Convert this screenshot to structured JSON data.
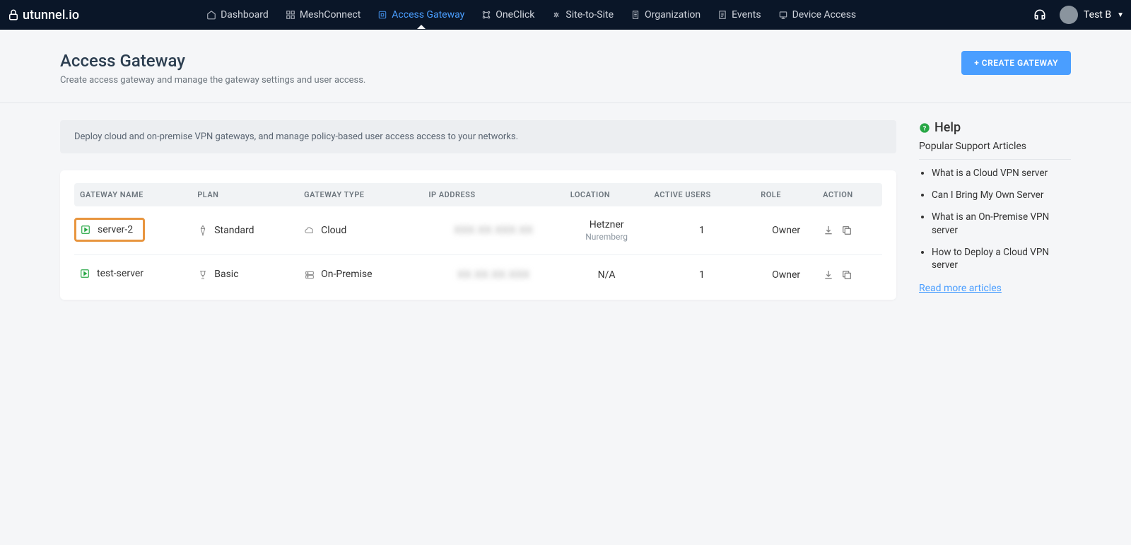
{
  "brand": "utunnel.io",
  "nav": [
    {
      "label": "Dashboard",
      "icon": "home"
    },
    {
      "label": "MeshConnect",
      "icon": "mesh"
    },
    {
      "label": "Access Gateway",
      "icon": "gateway",
      "active": true
    },
    {
      "label": "OneClick",
      "icon": "oneclick"
    },
    {
      "label": "Site-to-Site",
      "icon": "sitesite"
    },
    {
      "label": "Organization",
      "icon": "org"
    },
    {
      "label": "Events",
      "icon": "events"
    },
    {
      "label": "Device Access",
      "icon": "device"
    }
  ],
  "user": {
    "name": "Test B"
  },
  "page": {
    "title": "Access Gateway",
    "subtitle": "Create access gateway and manage the gateway settings and user access.",
    "create_button": "+ CREATE GATEWAY",
    "info": "Deploy cloud and on-premise VPN gateways, and manage policy-based user access access to your networks."
  },
  "table": {
    "columns": [
      "GATEWAY NAME",
      "PLAN",
      "GATEWAY TYPE",
      "IP ADDRESS",
      "LOCATION",
      "ACTIVE USERS",
      "ROLE",
      "ACTION"
    ],
    "rows": [
      {
        "name": "server-2",
        "highlighted": true,
        "plan": "Standard",
        "plan_icon": "diamond",
        "type": "Cloud",
        "type_icon": "cloud",
        "ip": "XXX.XX.XXX.XX",
        "location": "Hetzner",
        "location_sub": "Nuremberg",
        "active_users": "1",
        "role": "Owner"
      },
      {
        "name": "test-server",
        "highlighted": false,
        "plan": "Basic",
        "plan_icon": "trophy",
        "type": "On-Premise",
        "type_icon": "server",
        "ip": "XX.XX.XX.XXX",
        "location": "N/A",
        "location_sub": "",
        "active_users": "1",
        "role": "Owner"
      }
    ]
  },
  "help": {
    "title": "Help",
    "subtitle": "Popular Support Articles",
    "articles": [
      "What is a Cloud VPN server",
      "Can I Bring My Own Server",
      "What is an On-Premise VPN server",
      "How to Deploy a Cloud VPN server"
    ],
    "read_more": "Read more articles"
  }
}
